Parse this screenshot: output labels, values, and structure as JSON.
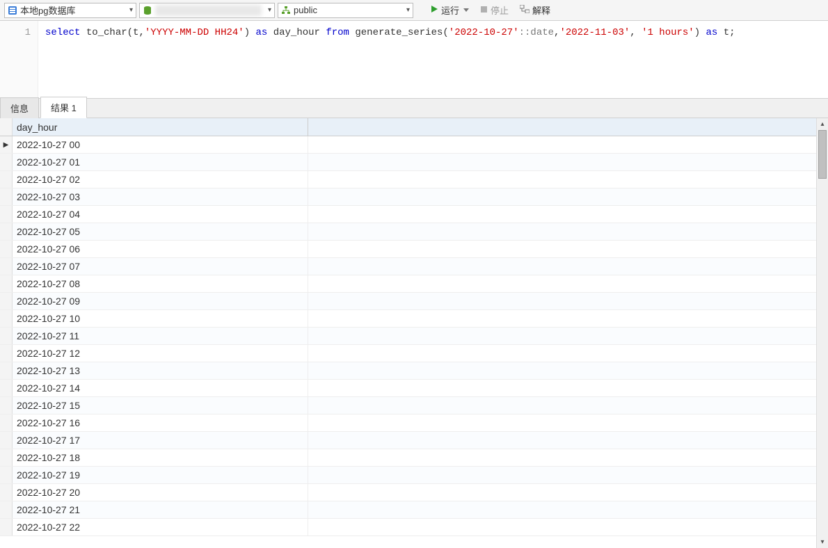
{
  "toolbar": {
    "connection": "本地pg数据库",
    "database": "",
    "schema": "public",
    "run_label": "运行",
    "stop_label": "停止",
    "explain_label": "解释"
  },
  "editor": {
    "line_number": "1",
    "tokens": {
      "select": "select",
      "fn_to_char": "to_char",
      "arg_t": "t",
      "fmt": "'YYYY-MM-DD HH24'",
      "as1": "as",
      "alias1": "day_hour",
      "from": "from",
      "fn_series": "generate_series",
      "d1": "'2022-10-27'",
      "cast": "::date",
      "d2": "'2022-11-03'",
      "interval": "'1 hours'",
      "as2": "as",
      "alias2": "t"
    }
  },
  "tabs": {
    "info": "信息",
    "result1": "结果 1"
  },
  "grid": {
    "column": "day_hour",
    "rows": [
      "2022-10-27 00",
      "2022-10-27 01",
      "2022-10-27 02",
      "2022-10-27 03",
      "2022-10-27 04",
      "2022-10-27 05",
      "2022-10-27 06",
      "2022-10-27 07",
      "2022-10-27 08",
      "2022-10-27 09",
      "2022-10-27 10",
      "2022-10-27 11",
      "2022-10-27 12",
      "2022-10-27 13",
      "2022-10-27 14",
      "2022-10-27 15",
      "2022-10-27 16",
      "2022-10-27 17",
      "2022-10-27 18",
      "2022-10-27 19",
      "2022-10-27 20",
      "2022-10-27 21",
      "2022-10-27 22"
    ]
  }
}
